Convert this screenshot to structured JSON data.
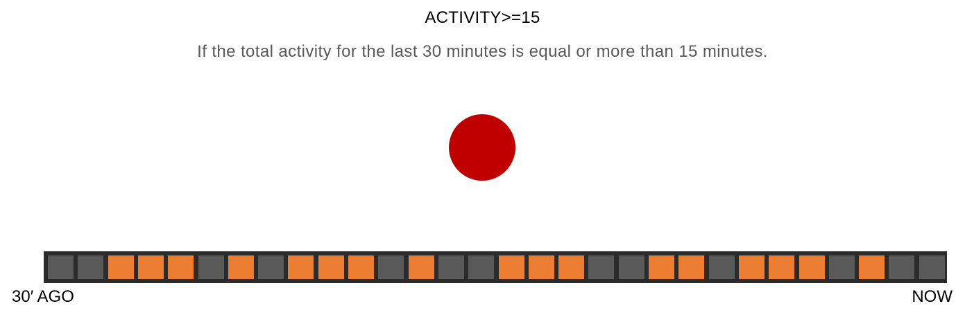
{
  "header": {
    "title": "ACTIVITY>=15",
    "description": "If the total activity for the last 30 minutes is equal or more than 15 minutes."
  },
  "indicator": {
    "state": "not-met",
    "color": "#c00000"
  },
  "timeline": {
    "start_label": "30′ AGO",
    "end_label": "NOW",
    "colors": {
      "active": "#ed7d31",
      "inactive": "#595959",
      "frame": "#2b2b2b"
    },
    "minutes": [
      0,
      0,
      1,
      1,
      1,
      0,
      1,
      0,
      1,
      1,
      1,
      0,
      1,
      0,
      0,
      1,
      1,
      1,
      0,
      0,
      1,
      1,
      0,
      1,
      1,
      1,
      0,
      1,
      0,
      0
    ]
  }
}
